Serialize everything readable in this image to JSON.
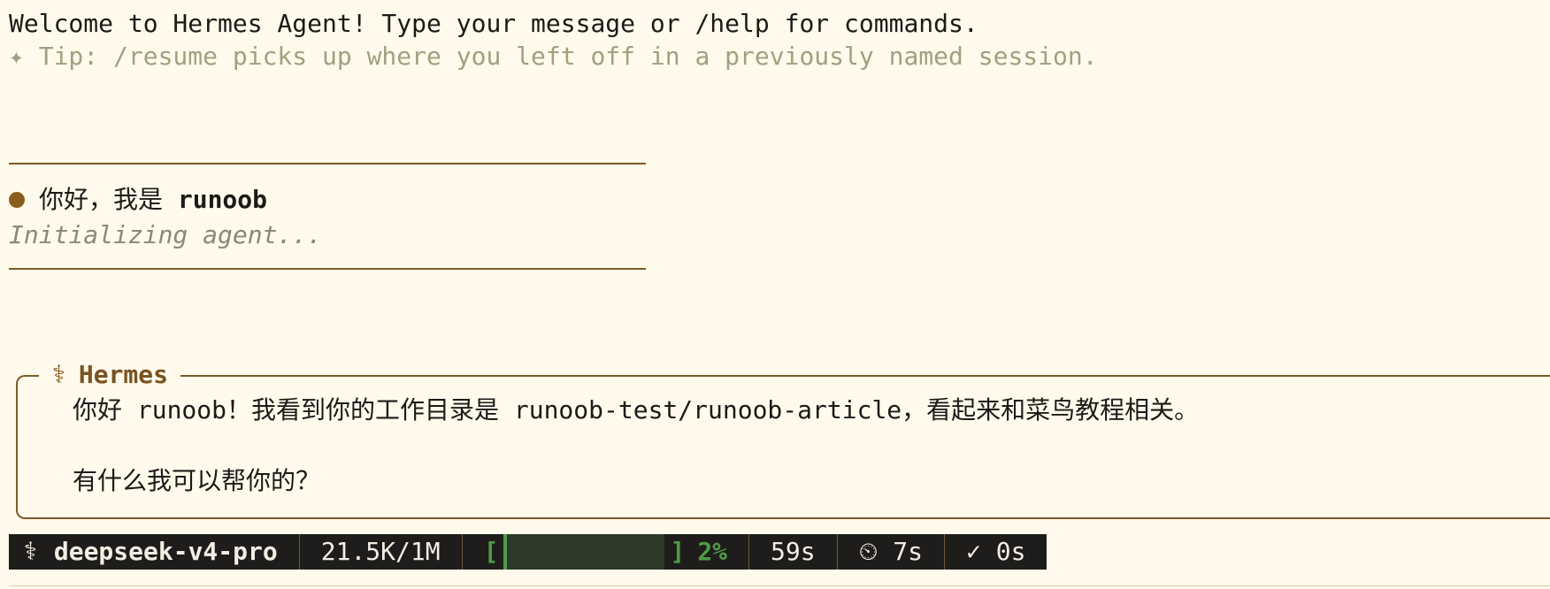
{
  "welcome": "Welcome to Hermes Agent! Type your message or /help for commands.",
  "tip": "✦ Tip: /resume picks up where you left off in a previously named session.",
  "user_message": {
    "prefix": "你好，我是 ",
    "name": "runoob"
  },
  "status_text": "Initializing agent...",
  "response": {
    "icon": "caduceus-icon",
    "title": "Hermes",
    "line1": "你好 runoob！我看到你的工作目录是 runoob-test/runoob-article，看起来和菜鸟教程相关。",
    "line2": "有什么我可以帮你的？"
  },
  "statusbar": {
    "model": "deepseek-v4-pro",
    "tokens": "21.5K/1M",
    "bar_open": "[",
    "bar_close": "]",
    "context_percent": "2%",
    "context_fraction": 0.02,
    "elapsed": "59s",
    "timer": "⏲ 7s",
    "done": "✓ 0s"
  },
  "colors": {
    "background": "#fffaeb",
    "accent": "#7c5a2a",
    "status_bg": "#1e1d1b",
    "progress": "#4f9a46"
  }
}
